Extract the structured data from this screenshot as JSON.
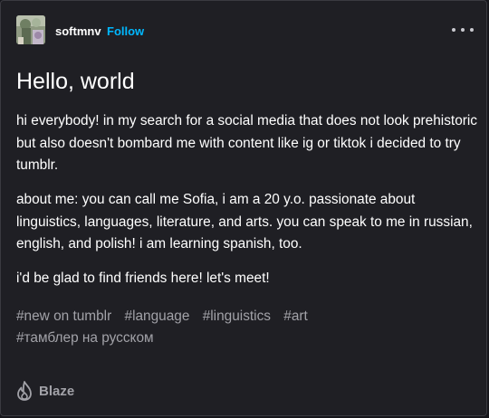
{
  "post": {
    "author": "softmnv",
    "follow_label": "Follow",
    "title": "Hello, world",
    "paragraphs": [
      "hi everybody! in my search for a social media that does not look prehistoric but also doesn't bombard me with content like ig or tiktok i decided to try tumblr.",
      "about me: you can call me Sofia, i am a 20 y.o. passionate about linguistics, languages, literature, and arts. you can speak to me in russian, english, and polish! i am learning spanish, too.",
      "i'd be glad to find friends here! let's meet!"
    ],
    "tags": [
      "#new on tumblr",
      "#language",
      "#linguistics",
      "#art",
      "#тамблер на русском"
    ],
    "blaze_label": "Blaze"
  },
  "icons": {
    "more": "more-horizontal-icon",
    "blaze": "flame-icon"
  },
  "colors": {
    "background": "#1f1f24",
    "accent": "#00b8ff",
    "tag_text": "#a2a2a8"
  }
}
